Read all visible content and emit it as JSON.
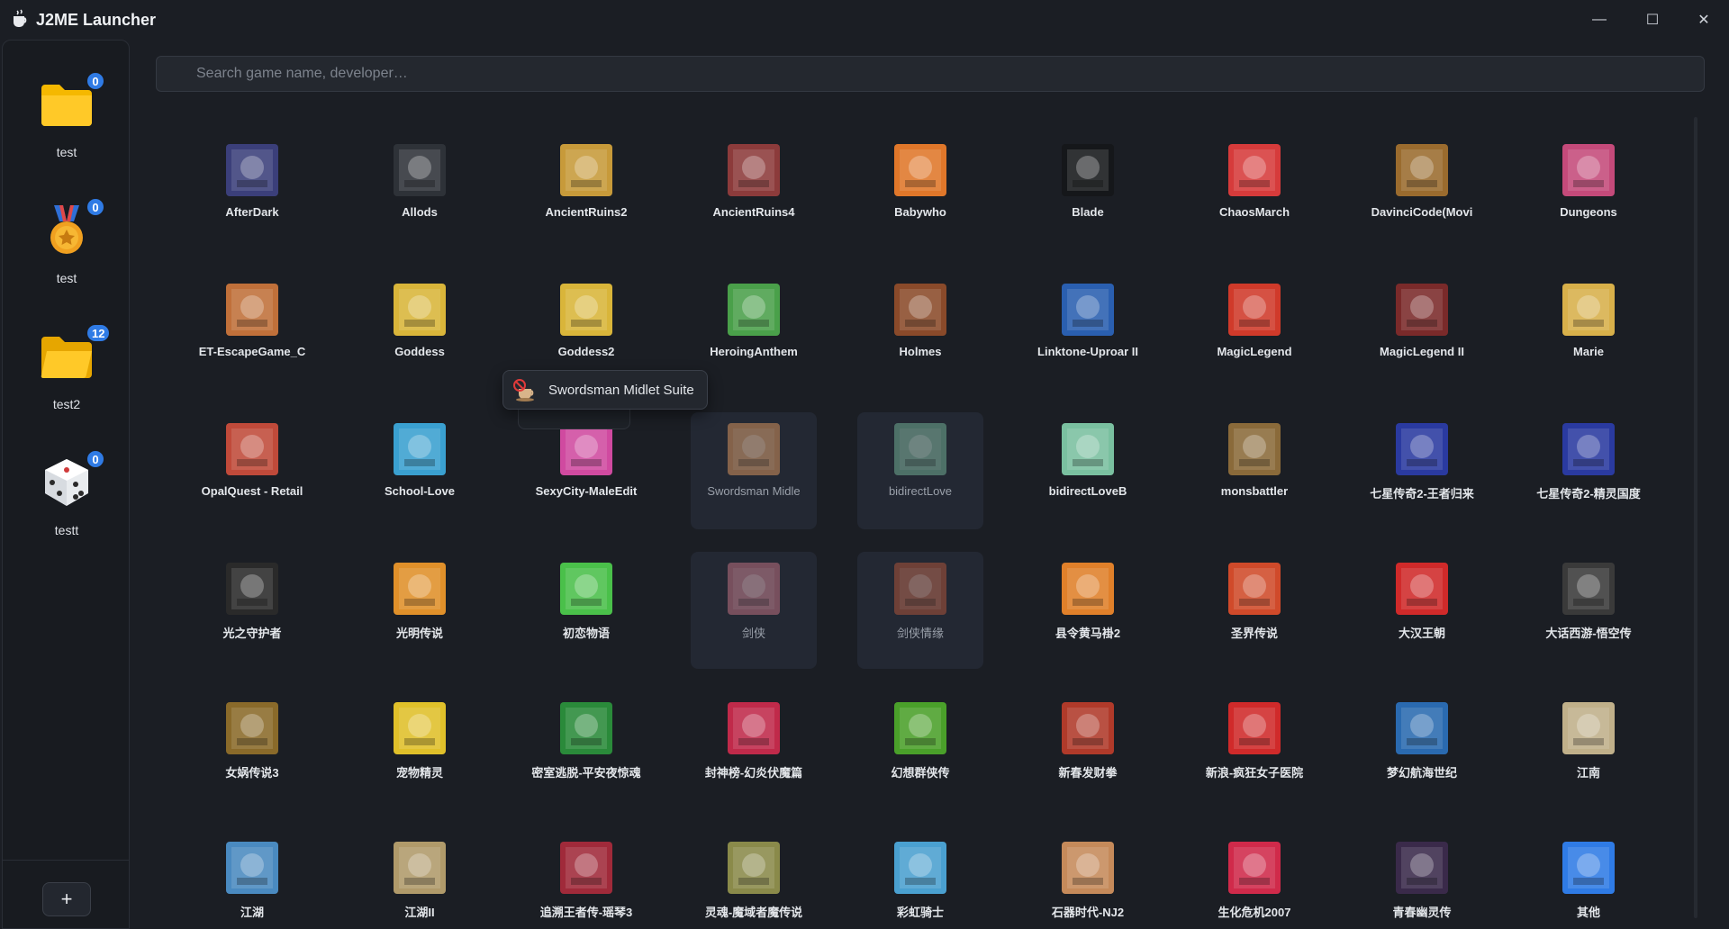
{
  "window": {
    "title": "J2ME Launcher",
    "minimize": "—",
    "maximize": "☐",
    "close": "✕"
  },
  "sidebar": {
    "items": [
      {
        "label": "test",
        "badge": "0",
        "icon": "folder-icon"
      },
      {
        "label": "test",
        "badge": "0",
        "icon": "medal-icon"
      },
      {
        "label": "test2",
        "badge": "12",
        "icon": "folder-open-icon"
      },
      {
        "label": "testt",
        "badge": "0",
        "icon": "dice-icon"
      }
    ],
    "add_label": "+"
  },
  "search": {
    "placeholder": "Search game name, developer…"
  },
  "tooltip": {
    "text": "Swordsman Midlet Suite",
    "icon": "coffee-blocked-icon"
  },
  "games": [
    {
      "name": "AfterDark",
      "color": "#3b3f7a"
    },
    {
      "name": "Allods",
      "color": "#2e3238"
    },
    {
      "name": "AncientRuins2",
      "color": "#c79a3a"
    },
    {
      "name": "AncientRuins4",
      "color": "#8c3b3b"
    },
    {
      "name": "Babywho",
      "color": "#e0772a"
    },
    {
      "name": "Blade",
      "color": "#15171a"
    },
    {
      "name": "ChaosMarch",
      "color": "#d63b3b"
    },
    {
      "name": "DavinciCode(Movi",
      "color": "#9a6b2e"
    },
    {
      "name": "Dungeons",
      "color": "#c44a7a"
    },
    {
      "name": "ET-EscapeGame_C",
      "color": "#c0703a"
    },
    {
      "name": "Goddess",
      "color": "#d9b53a"
    },
    {
      "name": "Goddess2",
      "color": "#d9b53a"
    },
    {
      "name": "HeroingAnthem",
      "color": "#4aa04a"
    },
    {
      "name": "Holmes",
      "color": "#8a4a2a"
    },
    {
      "name": "Linktone-Uproar II",
      "color": "#2a5fb0"
    },
    {
      "name": "MagicLegend",
      "color": "#d03a2a"
    },
    {
      "name": "MagicLegend II",
      "color": "#7a2a2a"
    },
    {
      "name": "Marie",
      "color": "#d8b04a"
    },
    {
      "name": "OpalQuest - Retail",
      "color": "#c04a3a"
    },
    {
      "name": "School-Love",
      "color": "#3aa0d0"
    },
    {
      "name": "SexyCity-MaleEdit",
      "color": "#d04aa0"
    },
    {
      "name": "Swordsman Midle",
      "color": "#c58a5a"
    },
    {
      "name": "bidirectLove",
      "color": "#6aa08a"
    },
    {
      "name": "bidirectLoveB",
      "color": "#7ac0a0"
    },
    {
      "name": "monsbattler",
      "color": "#8a6a3a"
    },
    {
      "name": "七星传奇2-王者归来",
      "color": "#2a3aa0"
    },
    {
      "name": "七星传奇2-精灵国度",
      "color": "#2a3aa0"
    },
    {
      "name": "光之守护者",
      "color": "#2a2a2a"
    },
    {
      "name": "光明传说",
      "color": "#e0902a"
    },
    {
      "name": "初恋物语",
      "color": "#4ac04a"
    },
    {
      "name": "剑侠",
      "color": "#b06a7a"
    },
    {
      "name": "剑侠情缘",
      "color": "#a0503a"
    },
    {
      "name": "县令黄马褂2",
      "color": "#e0802a"
    },
    {
      "name": "圣界传说",
      "color": "#d04a2a"
    },
    {
      "name": "大汉王朝",
      "color": "#d02a2a"
    },
    {
      "name": "大话西游-悟空传",
      "color": "#3a3a3a"
    },
    {
      "name": "女娲传说3",
      "color": "#8a6a2a"
    },
    {
      "name": "宠物精灵",
      "color": "#e0c02a"
    },
    {
      "name": "密室逃脱-平安夜惊魂",
      "color": "#2a8a3a"
    },
    {
      "name": "封神榜-幻炎伏魔篇",
      "color": "#c02a4a"
    },
    {
      "name": "幻想群侠传",
      "color": "#4aa02a"
    },
    {
      "name": "新春发财拳",
      "color": "#b03a2a"
    },
    {
      "name": "新浪-疯狂女子医院",
      "color": "#d02a2a"
    },
    {
      "name": "梦幻航海世纪",
      "color": "#2a6ab0"
    },
    {
      "name": "江南",
      "color": "#c0b08a"
    },
    {
      "name": "江湖",
      "color": "#4a8ac0"
    },
    {
      "name": "江湖II",
      "color": "#b09a6a"
    },
    {
      "name": "追溯王者传-瑶琴3",
      "color": "#a02a3a"
    },
    {
      "name": "灵魂-魔域者魔传说",
      "color": "#8a8a4a"
    },
    {
      "name": "彩虹骑士",
      "color": "#4aa0d0"
    },
    {
      "name": "石器时代-NJ2",
      "color": "#c58a5a"
    },
    {
      "name": "生化危机2007",
      "color": "#d02a4a"
    },
    {
      "name": "青春幽灵传",
      "color": "#3a2a4a"
    },
    {
      "name": "其他",
      "color": "#2f7be5"
    }
  ]
}
